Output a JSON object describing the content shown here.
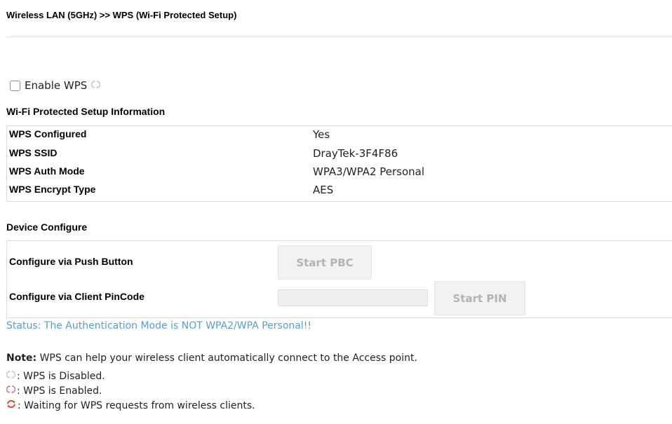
{
  "header": {
    "title": "Wireless LAN (5GHz) >> WPS (Wi-Fi Protected Setup)"
  },
  "enable_wps": {
    "label": "Enable WPS",
    "checked": false,
    "status_icon": "wps-disabled-icon"
  },
  "info": {
    "heading": "Wi-Fi Protected Setup Information",
    "rows": [
      {
        "label": "WPS Configured",
        "value": "Yes"
      },
      {
        "label": "WPS SSID",
        "value": "DrayTek-3F4F86"
      },
      {
        "label": "WPS Auth Mode",
        "value": "WPA3/WPA2 Personal"
      },
      {
        "label": "WPS Encrypt Type",
        "value": "AES"
      }
    ]
  },
  "device": {
    "heading": "Device Configure",
    "push_button_label": "Configure via Push Button",
    "start_pbc_label": "Start PBC",
    "pincode_label": "Configure via Client PinCode",
    "pincode_value": "",
    "start_pin_label": "Start PIN"
  },
  "status": {
    "text": "Status: The Authentication Mode is NOT WPA2/WPA Personal!!"
  },
  "note": {
    "label": "Note:",
    "text": " WPS can help your wireless client automatically connect to the Access point.",
    "legend": [
      {
        "icon": "wps-disabled-icon",
        "text": ": WPS is Disabled."
      },
      {
        "icon": "wps-enabled-icon",
        "text": ": WPS is Enabled."
      },
      {
        "icon": "wps-waiting-icon",
        "text": ": Waiting for WPS requests from wireless clients."
      }
    ]
  },
  "colors": {
    "status_text": "#5b9bd5",
    "disabled_icon": "#c8c8c8",
    "enabled_icon": "#e57373",
    "waiting_icon": "#e53935",
    "button_bg": "#f2f2f2",
    "button_text": "#b3b3b3"
  }
}
